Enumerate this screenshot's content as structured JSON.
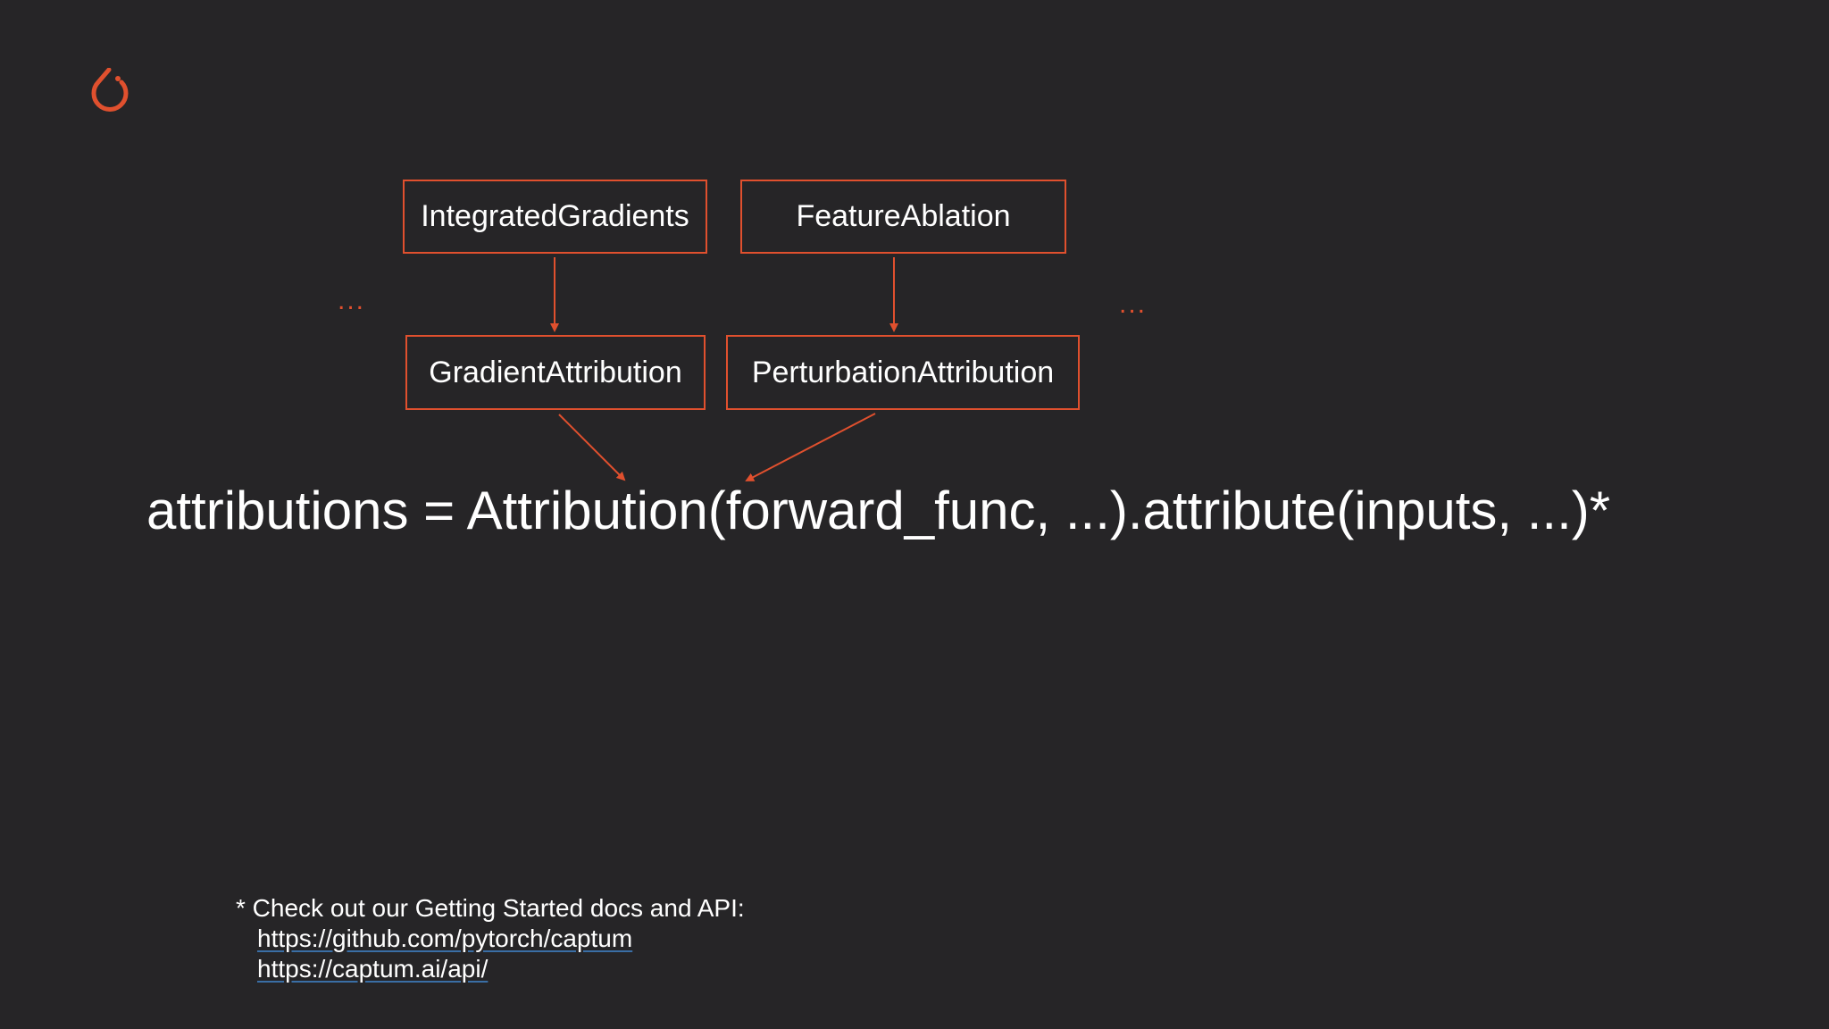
{
  "diagram": {
    "boxes": {
      "integrated_gradients": "IntegratedGradients",
      "feature_ablation": "FeatureAblation",
      "gradient_attribution": "GradientAttribution",
      "perturbation_attribution": "PerturbationAttribution"
    },
    "ellipsis_left": "...",
    "ellipsis_right": "...",
    "formula": "attributions = Attribution(forward_func, ...).attribute(inputs, ...)*"
  },
  "footnote": {
    "text": "* Check out our Getting Started docs and API:",
    "links": [
      "https://github.com/pytorch/captum",
      "https://captum.ai/api/"
    ]
  },
  "colors": {
    "background": "#262527",
    "accent": "#e0502e",
    "text": "#ffffff"
  },
  "icons": {
    "logo": "pytorch-flame-icon"
  }
}
